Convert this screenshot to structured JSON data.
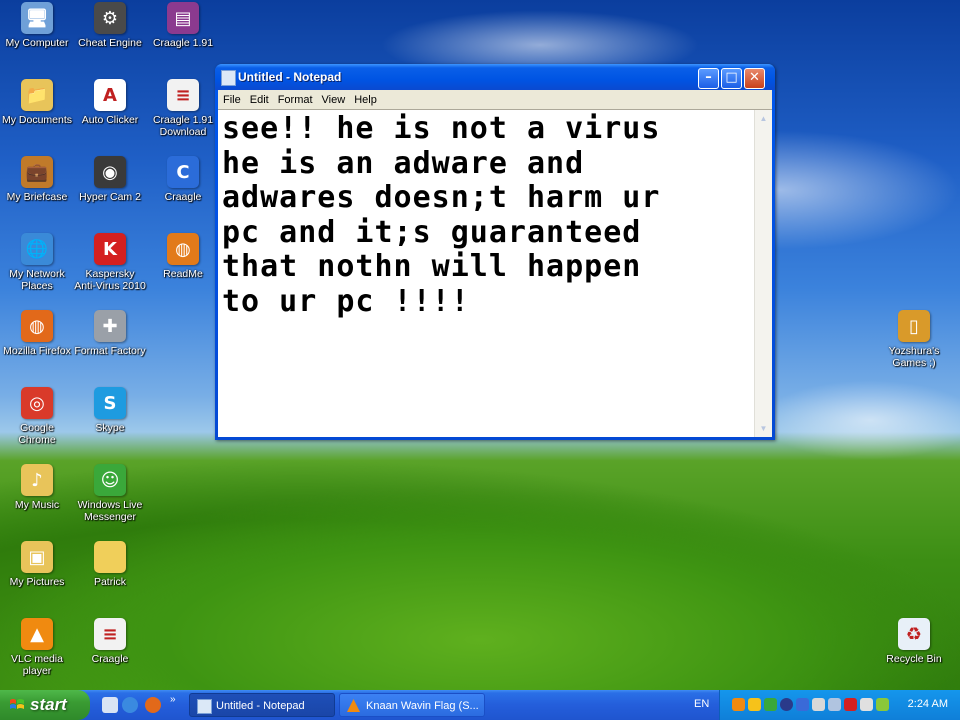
{
  "desktop": {
    "icons": [
      {
        "id": "my-computer",
        "label": "My Computer",
        "icon": "computer-icon",
        "color": "#6fa0d8",
        "glyph": "🖥"
      },
      {
        "id": "cheat-engine",
        "label": "Cheat Engine",
        "icon": "cheat-engine-icon",
        "color": "#4a4a4a",
        "glyph": "⚙"
      },
      {
        "id": "craagle-191",
        "label": "Craagle 1.91",
        "icon": "winrar-archive-icon",
        "color": "#8b3a8f",
        "glyph": "▤"
      },
      {
        "id": "my-documents",
        "label": "My Documents",
        "icon": "folder-documents-icon",
        "color": "#e8c45a",
        "glyph": "📁"
      },
      {
        "id": "auto-clicker",
        "label": "Auto Clicker",
        "icon": "auto-clicker-icon",
        "color": "#ffffff",
        "glyph": "A"
      },
      {
        "id": "craagle-download",
        "label": "Craagle 1.91\nDownload",
        "icon": "text-document-icon",
        "color": "#f2f2f2",
        "glyph": "≡"
      },
      {
        "id": "my-briefcase",
        "label": "My Briefcase",
        "icon": "briefcase-icon",
        "color": "#c07a2a",
        "glyph": "💼"
      },
      {
        "id": "hypercam",
        "label": "Hyper Cam 2",
        "icon": "hypercam-icon",
        "color": "#3a3a3a",
        "glyph": "◉"
      },
      {
        "id": "craagle",
        "label": "Craagle",
        "icon": "craagle-icon",
        "color": "#2b6cd9",
        "glyph": "C"
      },
      {
        "id": "network-places",
        "label": "My Network\nPlaces",
        "icon": "network-globe-icon",
        "color": "#3a8ad8",
        "glyph": "🌐"
      },
      {
        "id": "kaspersky",
        "label": "Kaspersky\nAnti-Virus 2010",
        "icon": "kaspersky-icon",
        "color": "#d42020",
        "glyph": "K"
      },
      {
        "id": "readme",
        "label": "ReadMe",
        "icon": "firefox-document-icon",
        "color": "#e27a1a",
        "glyph": "◍"
      },
      {
        "id": "firefox",
        "label": "Mozilla Firefox",
        "icon": "firefox-icon",
        "color": "#e2691a",
        "glyph": "◍"
      },
      {
        "id": "format-factory",
        "label": "Format Factory",
        "icon": "format-factory-icon",
        "color": "#9aa0a8",
        "glyph": "✚"
      },
      {
        "id": "chrome",
        "label": "Google Chrome",
        "icon": "chrome-icon",
        "color": "#d93a2a",
        "glyph": "◎"
      },
      {
        "id": "skype",
        "label": "Skype",
        "icon": "skype-icon",
        "color": "#1e9be0",
        "glyph": "S"
      },
      {
        "id": "my-music",
        "label": "My Music",
        "icon": "folder-music-icon",
        "color": "#e8c45a",
        "glyph": "♪"
      },
      {
        "id": "live-messenger",
        "label": "Windows Live\nMessenger",
        "icon": "messenger-icon",
        "color": "#3aa83a",
        "glyph": "☺"
      },
      {
        "id": "my-pictures",
        "label": "My Pictures",
        "icon": "folder-pictures-icon",
        "color": "#e8c45a",
        "glyph": "▣"
      },
      {
        "id": "patrick",
        "label": "Patrick",
        "icon": "folder-icon",
        "color": "#f0cf5a",
        "glyph": ""
      },
      {
        "id": "vlc",
        "label": "VLC media\nplayer",
        "icon": "vlc-cone-icon",
        "color": "#f08a10",
        "glyph": "▲"
      },
      {
        "id": "craagle-doc",
        "label": "Craagle",
        "icon": "text-document-icon",
        "color": "#f2f2f2",
        "glyph": "≡"
      },
      {
        "id": "yozshura",
        "label": "Yozshura's\nGames ;)",
        "icon": "phone-games-icon",
        "color": "#d99a2a",
        "glyph": "▯"
      },
      {
        "id": "recycle-bin",
        "label": "Recycle Bin",
        "icon": "recycle-bin-icon",
        "color": "#e8f0f8",
        "glyph": "♻"
      }
    ]
  },
  "notepad": {
    "title": "Untitled - Notepad",
    "menu": [
      "File",
      "Edit",
      "Format",
      "View",
      "Help"
    ],
    "content": "see!! he is not a virus\nhe is an adware and\nadwares doesn;t harm ur\npc and it;s guaranteed\nthat nothn will happen\nto ur pc !!!!"
  },
  "taskbar": {
    "start_label": "start",
    "tasks": [
      {
        "label": "Untitled - Notepad",
        "active": true
      },
      {
        "label": "Knaan Wavin Flag (S...",
        "active": false
      }
    ],
    "language": "EN",
    "clock": "2:24 AM"
  }
}
